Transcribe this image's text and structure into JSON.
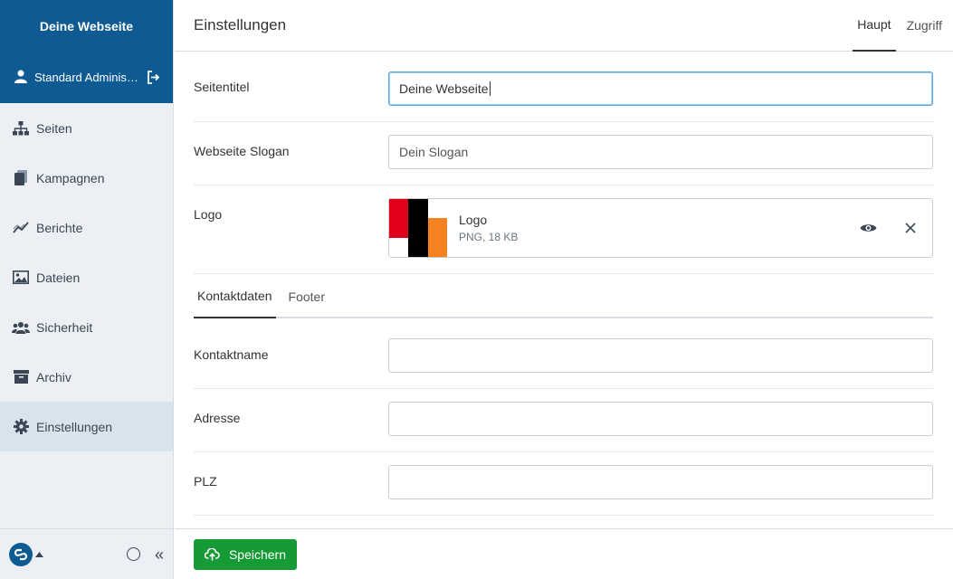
{
  "sidebar": {
    "brand": "Deine Webseite",
    "user": "Standard Adminis…",
    "items": [
      {
        "label": "Seiten",
        "icon": "sitemap-icon"
      },
      {
        "label": "Kampagnen",
        "icon": "document-icon"
      },
      {
        "label": "Berichte",
        "icon": "chart-line-icon"
      },
      {
        "label": "Dateien",
        "icon": "image-icon"
      },
      {
        "label": "Sicherheit",
        "icon": "users-icon"
      },
      {
        "label": "Archiv",
        "icon": "archive-icon"
      },
      {
        "label": "Einstellungen",
        "icon": "gear-icon",
        "active": true
      }
    ],
    "collapse_glyph": "«"
  },
  "header": {
    "title": "Einstellungen",
    "tabs": [
      {
        "label": "Haupt",
        "active": true
      },
      {
        "label": "Zugriff",
        "active": false
      }
    ]
  },
  "form": {
    "site_title": {
      "label": "Seitentitel",
      "value": "Deine Webseite"
    },
    "slogan": {
      "label": "Webseite Slogan",
      "placeholder": "Dein Slogan"
    },
    "logo": {
      "label": "Logo",
      "file_name": "Logo",
      "file_meta": "PNG, 18 KB"
    },
    "subtabs": [
      {
        "label": "Kontaktdaten",
        "active": true
      },
      {
        "label": "Footer",
        "active": false
      }
    ],
    "contact_name": {
      "label": "Kontaktname",
      "value": ""
    },
    "address": {
      "label": "Adresse",
      "value": ""
    },
    "zip": {
      "label": "PLZ",
      "value": ""
    }
  },
  "footer": {
    "save_label": "Speichern"
  },
  "colors": {
    "brand": "#0e5a93",
    "sidebar_bg": "#ecf0f4",
    "active_nav": "#d9e3ec",
    "save_button": "#169a35",
    "focus_border": "#5aa6e0",
    "logo_red": "#e0001a",
    "logo_black": "#000000",
    "logo_orange": "#f58220"
  }
}
